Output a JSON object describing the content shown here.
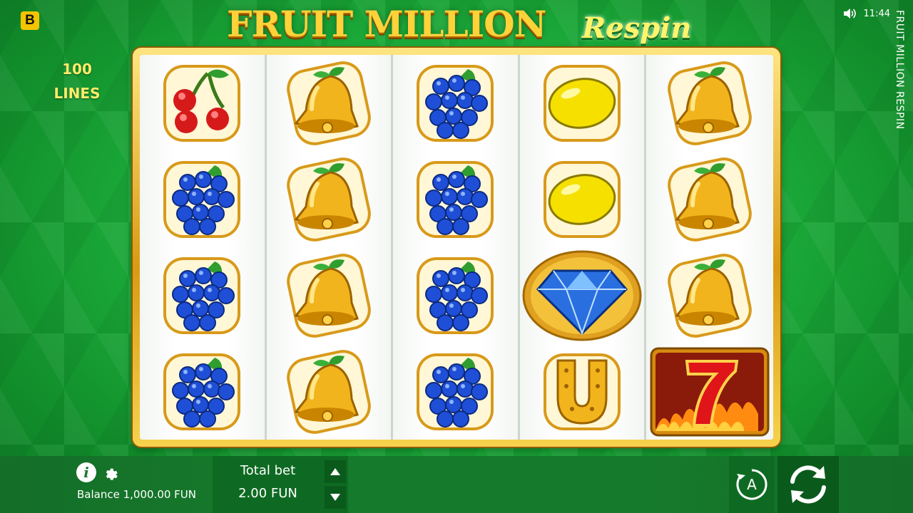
{
  "brand": {
    "badge": "B"
  },
  "title": {
    "main": "FRUIT MILLION",
    "sub": "Respin"
  },
  "lines_info": {
    "count": "100",
    "label": "LINES"
  },
  "status": {
    "time": "11:44",
    "sound_icon": "speaker-icon"
  },
  "side_title": "FRUIT MILLION RESPIN",
  "reels": [
    [
      "cherry",
      "grapes",
      "grapes",
      "grapes"
    ],
    [
      "bell",
      "bell",
      "bell",
      "bell"
    ],
    [
      "grapes",
      "grapes",
      "grapes",
      "grapes"
    ],
    [
      "lemon",
      "lemon",
      "diamond",
      "horseshoe"
    ],
    [
      "bell",
      "bell",
      "bell",
      "seven"
    ]
  ],
  "bottom": {
    "info_icon": "info-icon",
    "settings_icon": "gear-icon",
    "balance_label": "Balance",
    "balance_value": "1,000.00 FUN",
    "total_bet_label": "Total bet",
    "total_bet_value": "2.00 FUN",
    "autoplay_label": "A",
    "spin_icon": "spin-icon"
  },
  "colors": {
    "background": "#1eb33e",
    "frame_gold": "#d99a13",
    "bar": "#167a2c",
    "accent_yellow": "#f5c400"
  }
}
